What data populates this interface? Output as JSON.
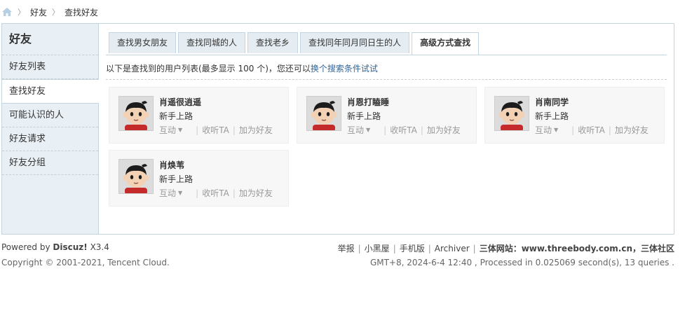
{
  "breadcrumb": {
    "home_icon": "home-icon",
    "items": [
      "好友",
      "查找好友"
    ]
  },
  "sidebar": {
    "title": "好友",
    "items": [
      {
        "label": "好友列表"
      },
      {
        "label": "查找好友"
      },
      {
        "label": "可能认识的人"
      },
      {
        "label": "好友请求"
      },
      {
        "label": "好友分组"
      }
    ],
    "active_index": 1
  },
  "tabs": [
    "查找男女朋友",
    "查找同城的人",
    "查找老乡",
    "查找同年同月同日生的人",
    "高级方式查找"
  ],
  "active_tab": 4,
  "tip": {
    "text": "以下是查找到的用户列表(最多显示 100 个)，您还可以",
    "link": "换个搜索条件试试"
  },
  "users": [
    {
      "name": "肖遥很逍遥",
      "level": "新手上路",
      "interact": "互动",
      "listen": "收听TA",
      "add": "加为好友"
    },
    {
      "name": "肖恩打瞌睡",
      "level": "新手上路",
      "interact": "互动",
      "listen": "收听TA",
      "add": "加为好友"
    },
    {
      "name": "肖南同学",
      "level": "新手上路",
      "interact": "互动",
      "listen": "收听TA",
      "add": "加为好友"
    },
    {
      "name": "肖焕苇",
      "level": "新手上路",
      "interact": "互动",
      "listen": "收听TA",
      "add": "加为好友"
    }
  ],
  "footer": {
    "powered_prefix": "Powered by",
    "powered_brand": "Discuz!",
    "powered_version": "X3.4",
    "copyright": "Copyright © 2001-2021, Tencent Cloud.",
    "links": [
      "举报",
      "小黑屋",
      "手机版",
      "Archiver"
    ],
    "site_label": "三体网站：www.threebody.com.cn，三体社区",
    "status": "GMT+8, 2024-6-4 12:40 , Processed in 0.025069 second(s), 13 queries ."
  },
  "colors": {
    "link": "#336699",
    "border": "#c2d5e3",
    "sidebar_bg": "#e8eff5"
  }
}
